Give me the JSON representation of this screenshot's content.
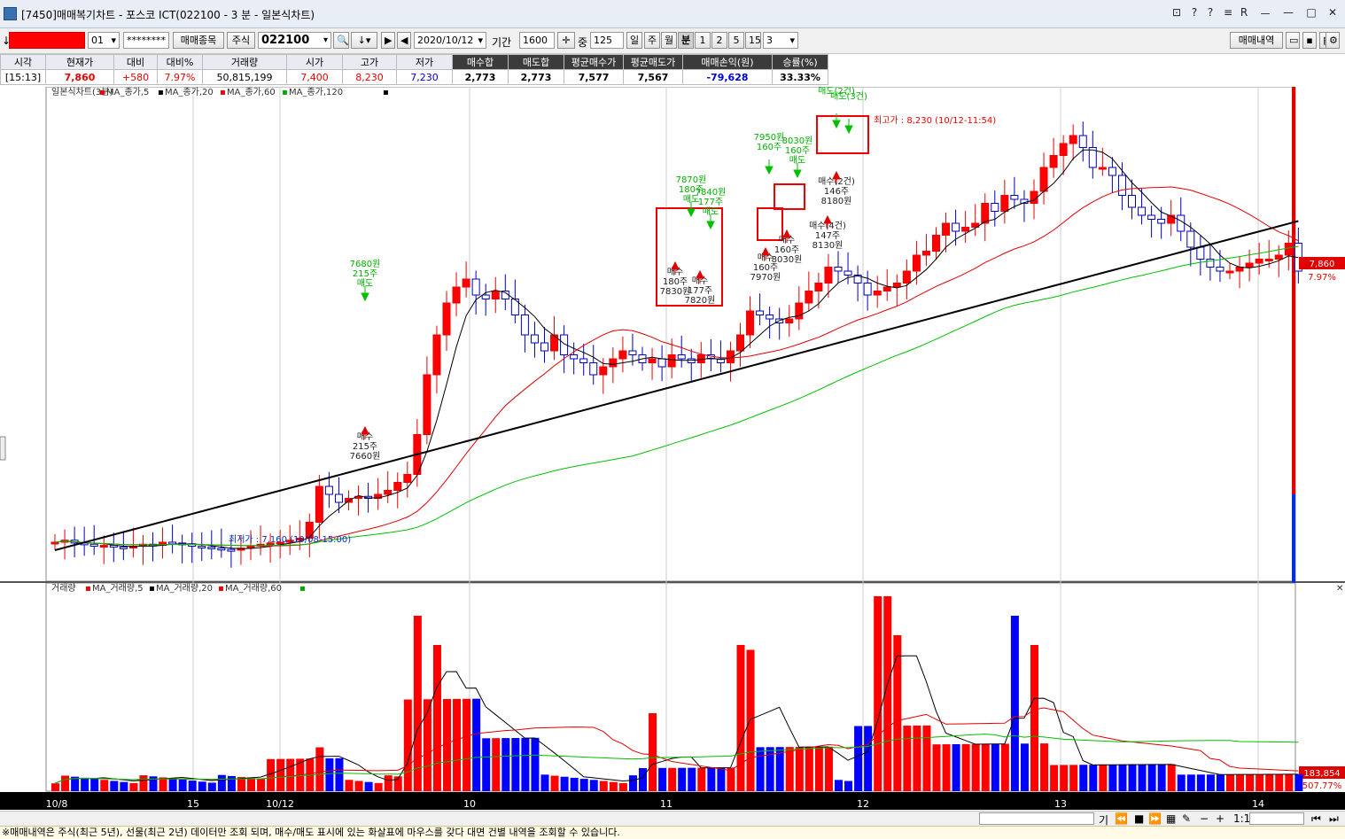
{
  "window": {
    "title": "[7450]매매복기차트 - 포스코 ICT(022100 - 3 분 - 일본식차트)",
    "controls": [
      "?",
      "?",
      "≡",
      "R",
      "ㅡ",
      "—",
      "□",
      "✕"
    ]
  },
  "toolbar": {
    "account_arrow": "↓",
    "account_suffix": "01",
    "password": "********",
    "trade_item_button": "매매종목",
    "market": "주식",
    "stock_code": "022100",
    "date": "2020/10/12",
    "period_label": "기간",
    "period_value": "1600",
    "count_label": "중",
    "count_value": "125",
    "period_buttons": [
      "일",
      "주",
      "월",
      "분"
    ],
    "minute_buttons": [
      "1",
      "2",
      "5",
      "15"
    ],
    "minute_select": "3",
    "history_button": "매매내역"
  },
  "quote": {
    "headers": [
      "시각",
      "현재가",
      "대비",
      "대비%",
      "거래량",
      "시가",
      "고가",
      "저가",
      "매수합",
      "매도합",
      "평균매수가",
      "평균매도가",
      "매매손익(원)",
      "승률(%)"
    ],
    "values": [
      "[15:13]",
      "7,860",
      "+580",
      "7.97%",
      "50,815,199",
      "7,400",
      "8,230",
      "7,230",
      "2,773",
      "2,773",
      "7,577",
      "7,567",
      "-79,628",
      "33.33%"
    ]
  },
  "price_chart": {
    "legend": [
      "일본식차트(3분)",
      "MA_종가,5",
      "MA_종가,20",
      "MA_종가,60",
      "MA_종가,120"
    ],
    "high_label": "최고가 : 8,230 (10/12-11:54)",
    "low_label": "최저가 : 7,160 (10/08-15:00)",
    "last_price": "7,860",
    "last_pct": "7.97%",
    "annotations": [
      {
        "text": "매수",
        "sub": "215주",
        "price": "7660원"
      },
      {
        "text": "7680원",
        "sub": "215주",
        "price": "매도"
      },
      {
        "text": "7870원",
        "sub": "180주",
        "price": "매도"
      },
      {
        "text": "7840원",
        "sub": "177주",
        "price": "매도"
      },
      {
        "text": "매수",
        "sub": "180주",
        "price": "7830원"
      },
      {
        "text": "매수",
        "sub": "177주",
        "price": "7820원"
      },
      {
        "text": "7950원",
        "sub": "160주",
        "price": ""
      },
      {
        "text": "8030원",
        "sub": "160주",
        "price": "매도"
      },
      {
        "text": "매수",
        "sub": "160주",
        "price": "7970원"
      },
      {
        "text": "매수",
        "sub": "160주",
        "price": "8030원"
      },
      {
        "text": "매수(4건)",
        "sub": "147주",
        "price": "8130원"
      },
      {
        "text": "매수(2건)",
        "sub": "146주",
        "price": "8180원"
      },
      {
        "text": "매도(2건)",
        "sub": "",
        "price": ""
      },
      {
        "text": "매도(3건)",
        "sub": "",
        "price": ""
      }
    ]
  },
  "volume_chart": {
    "legend": [
      "거래량",
      "MA_거래량,5",
      "MA_거래량,20",
      "MA_거래량,60"
    ],
    "last_volume": "183,854",
    "last_pct": "507.77%"
  },
  "x_axis": [
    "10/8",
    "15",
    "10/12",
    "10",
    "11",
    "12",
    "13",
    "14"
  ],
  "scroll": {
    "zoom": "1:1",
    "label": "기"
  },
  "status": "※매매내역은 주식(최근 5년), 선물(최근 2년) 데이터만 조회 되며, 매수/매도 표시에 있는 화살표에 마우스를 갖다 대면 건별 내역을 조회할 수 있습니다.",
  "colors": {
    "up": "#ff0000",
    "down": "#0000ff",
    "ma5": "#000000",
    "ma20": "#e00000",
    "ma60": "#00c000",
    "ma120": "#000000",
    "buy": "#ff0000",
    "sell": "#00cc00"
  }
}
